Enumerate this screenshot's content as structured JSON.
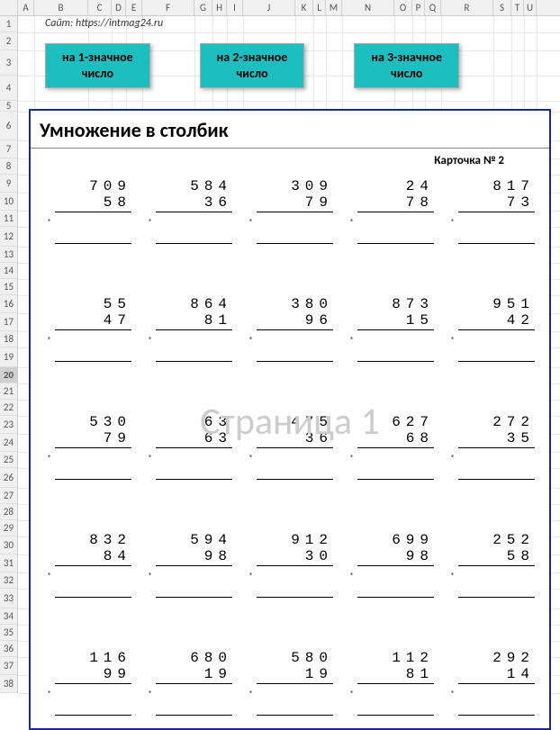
{
  "columns": [
    {
      "label": "",
      "w": 20
    },
    {
      "label": "A",
      "w": 18
    },
    {
      "label": "B",
      "w": 60
    },
    {
      "label": "C",
      "w": 26
    },
    {
      "label": "D",
      "w": 16
    },
    {
      "label": "E",
      "w": 18
    },
    {
      "label": "F",
      "w": 58
    },
    {
      "label": "G",
      "w": 20
    },
    {
      "label": "H",
      "w": 16
    },
    {
      "label": "I",
      "w": 18
    },
    {
      "label": "J",
      "w": 58
    },
    {
      "label": "K",
      "w": 20
    },
    {
      "label": "L",
      "w": 14
    },
    {
      "label": "M",
      "w": 18
    },
    {
      "label": "N",
      "w": 58
    },
    {
      "label": "O",
      "w": 20
    },
    {
      "label": "P",
      "w": 14
    },
    {
      "label": "Q",
      "w": 18
    },
    {
      "label": "R",
      "w": 58
    },
    {
      "label": "S",
      "w": 20
    },
    {
      "label": "T",
      "w": 14
    },
    {
      "label": "U",
      "w": 14
    }
  ],
  "rows": [
    {
      "n": "1",
      "h": 18
    },
    {
      "n": "2",
      "h": 20
    },
    {
      "n": "3",
      "h": 28
    },
    {
      "n": "4",
      "h": 28
    },
    {
      "n": "5",
      "h": 12
    },
    {
      "n": "6",
      "h": 32
    },
    {
      "n": "7",
      "h": 20
    },
    {
      "n": "8",
      "h": 18
    },
    {
      "n": "9",
      "h": 20
    },
    {
      "n": "10",
      "h": 20
    },
    {
      "n": "11",
      "h": 18
    },
    {
      "n": "12",
      "h": 22
    },
    {
      "n": "13",
      "h": 18
    },
    {
      "n": "14",
      "h": 18
    },
    {
      "n": "15",
      "h": 18
    },
    {
      "n": "16",
      "h": 20
    },
    {
      "n": "17",
      "h": 20
    },
    {
      "n": "18",
      "h": 18
    },
    {
      "n": "19",
      "h": 22
    },
    {
      "n": "20",
      "h": 18,
      "sel": true
    },
    {
      "n": "21",
      "h": 18
    },
    {
      "n": "22",
      "h": 18
    },
    {
      "n": "23",
      "h": 20
    },
    {
      "n": "24",
      "h": 20
    },
    {
      "n": "25",
      "h": 18
    },
    {
      "n": "26",
      "h": 22
    },
    {
      "n": "27",
      "h": 18
    },
    {
      "n": "28",
      "h": 18
    },
    {
      "n": "29",
      "h": 18
    },
    {
      "n": "30",
      "h": 20
    },
    {
      "n": "31",
      "h": 20
    },
    {
      "n": "32",
      "h": 18
    },
    {
      "n": "33",
      "h": 22
    },
    {
      "n": "34",
      "h": 18
    },
    {
      "n": "35",
      "h": 18
    },
    {
      "n": "36",
      "h": 18
    },
    {
      "n": "37",
      "h": 20
    },
    {
      "n": "38",
      "h": 20
    }
  ],
  "site": "Сайт: https://intmag24.ru",
  "buttons": {
    "b1": "на 1-значное\nчисло",
    "b2": "на 2-значное\nчисло",
    "b3": "на 3-значное\nчисло"
  },
  "title": "Умножение в столбик",
  "card": "Карточка № 2",
  "watermark": "Страница 1",
  "problems": [
    [
      {
        "a": "709",
        "b": "58"
      },
      {
        "a": "584",
        "b": "36"
      },
      {
        "a": "309",
        "b": "79"
      },
      {
        "a": "24",
        "b": "78"
      },
      {
        "a": "817",
        "b": "73"
      }
    ],
    [
      {
        "a": "55",
        "b": "47"
      },
      {
        "a": "864",
        "b": "81"
      },
      {
        "a": "380",
        "b": "96"
      },
      {
        "a": "873",
        "b": "15"
      },
      {
        "a": "951",
        "b": "42"
      }
    ],
    [
      {
        "a": "530",
        "b": "79"
      },
      {
        "a": "63",
        "b": "63"
      },
      {
        "a": "475",
        "b": "36"
      },
      {
        "a": "627",
        "b": "68"
      },
      {
        "a": "272",
        "b": "35"
      }
    ],
    [
      {
        "a": "832",
        "b": "84"
      },
      {
        "a": "594",
        "b": "98"
      },
      {
        "a": "912",
        "b": "30"
      },
      {
        "a": "699",
        "b": "98"
      },
      {
        "a": "252",
        "b": "58"
      }
    ],
    [
      {
        "a": "116",
        "b": "99"
      },
      {
        "a": "680",
        "b": "19"
      },
      {
        "a": "580",
        "b": "19"
      },
      {
        "a": "112",
        "b": "81"
      },
      {
        "a": "292",
        "b": "14"
      }
    ]
  ]
}
